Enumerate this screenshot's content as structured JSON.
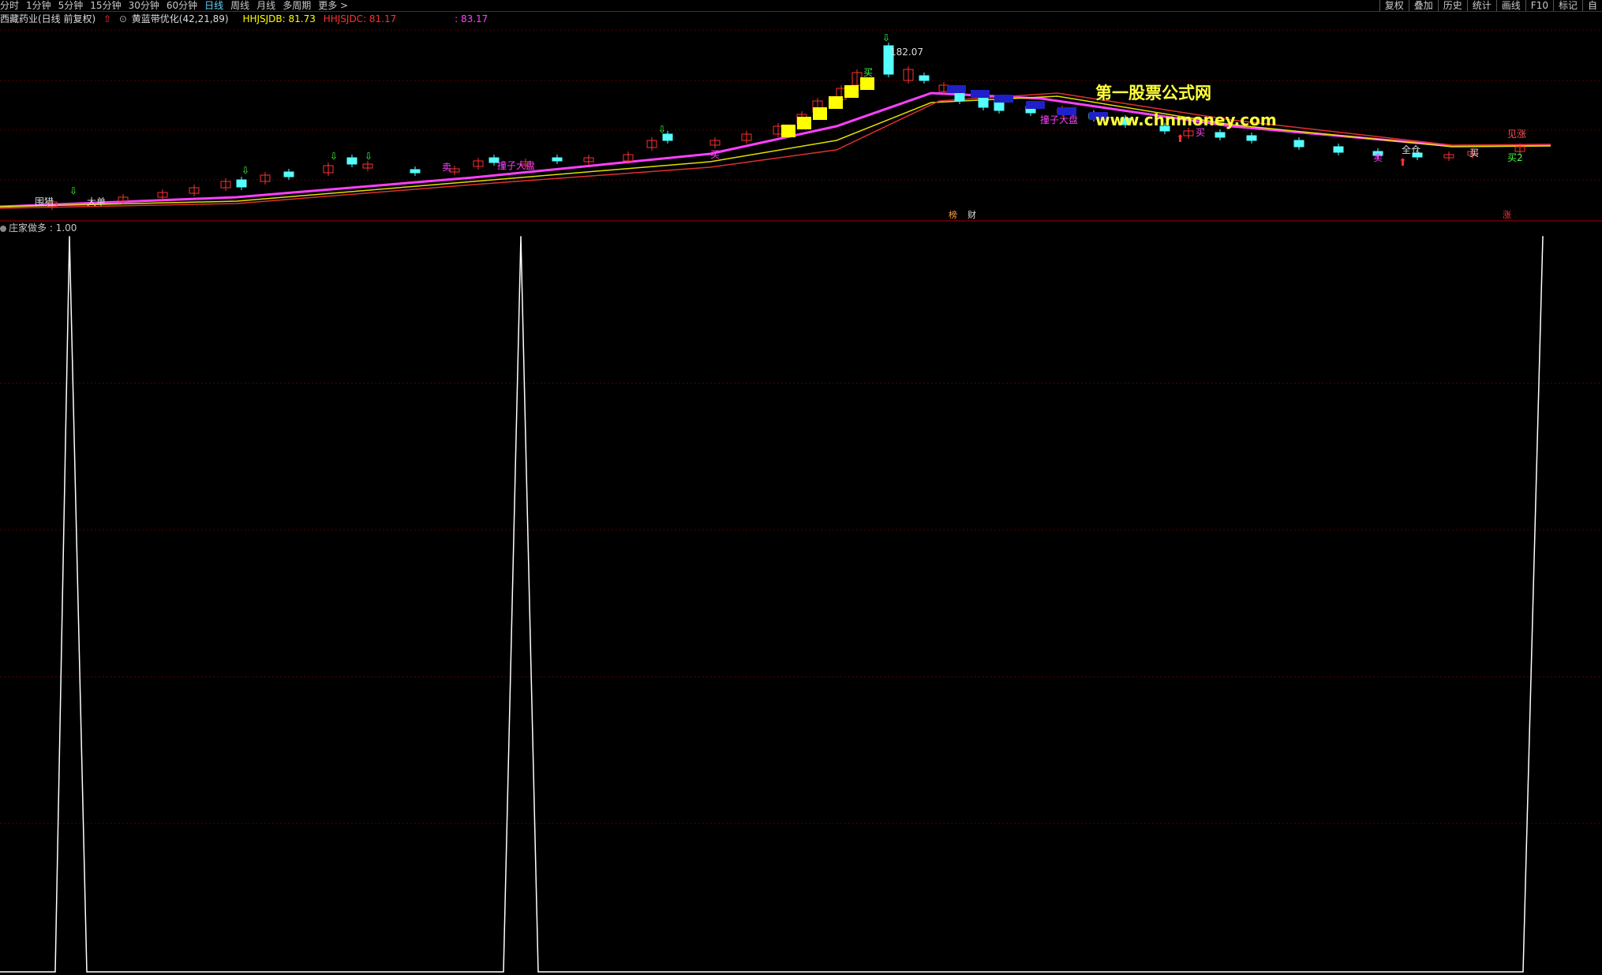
{
  "toolbar": {
    "periods": [
      {
        "label": "分时"
      },
      {
        "label": "1分钟"
      },
      {
        "label": "5分钟"
      },
      {
        "label": "15分钟"
      },
      {
        "label": "30分钟"
      },
      {
        "label": "60分钟"
      },
      {
        "label": "日线",
        "active": true
      },
      {
        "label": "周线"
      },
      {
        "label": "月线"
      },
      {
        "label": "多周期"
      },
      {
        "label": "更多 >"
      }
    ],
    "right_tools": [
      {
        "label": "复权"
      },
      {
        "label": "叠加"
      },
      {
        "label": "历史"
      },
      {
        "label": "统计"
      },
      {
        "label": "画线"
      },
      {
        "label": "F10"
      },
      {
        "label": "标记"
      },
      {
        "label": "自"
      }
    ]
  },
  "info": {
    "stock_name": "西藏药业(日线 前复权)",
    "indicator_name": "黄蓝带优化(42,21,89)",
    "hhjsjdb": "HHJSJDB: 81.73",
    "hhjsjdc": "HHJSJDC: 81.17",
    "third_value": ": 83.17",
    "colors": {
      "yellow": "#ffff00",
      "red": "#ff3030",
      "magenta": "#ff40ff"
    }
  },
  "chart": {
    "peak_label": "182.07",
    "annotations": [
      "围猎",
      "大单",
      "撞子大盘",
      "撞子大盘",
      "买",
      "卖",
      "买",
      "见涨",
      "全仓",
      "买",
      "买2",
      "买",
      "卖"
    ],
    "bottom_markers": [
      "榜",
      "财",
      "涨"
    ]
  },
  "watermark": {
    "line1": "第一股票公式网",
    "line2": "www.chnmoney.com"
  },
  "indicator": {
    "title": "庄家做多 : 1.00"
  },
  "chart_data": {
    "type": "line",
    "title": "庄家做多",
    "series": [
      {
        "name": "庄家做多",
        "x": [
          0,
          70,
          88,
          110,
          638,
          660,
          682,
          1930,
          1955,
          1955
        ],
        "y": [
          0,
          0,
          1,
          0,
          0,
          1,
          0,
          0,
          1,
          1
        ]
      }
    ],
    "ylim": [
      0,
      1
    ]
  }
}
